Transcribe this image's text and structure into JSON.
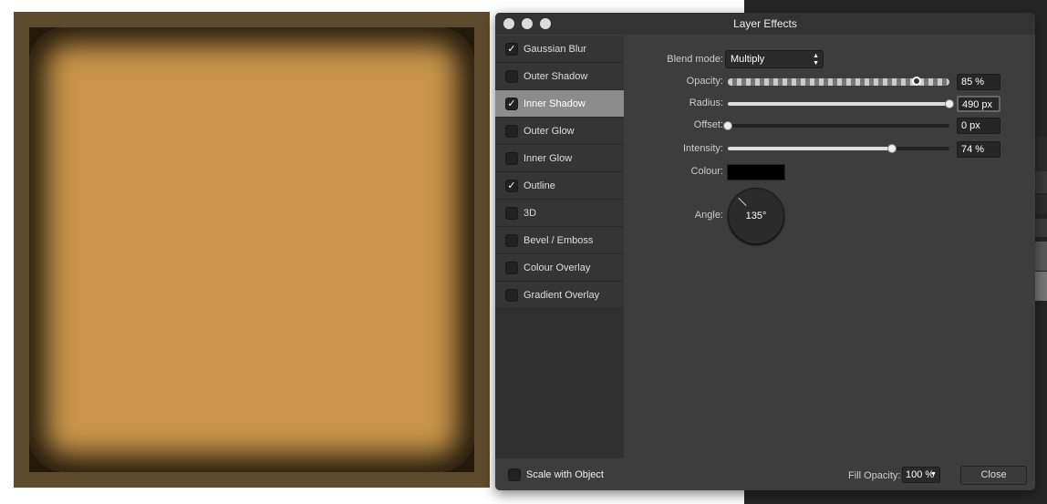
{
  "dialog": {
    "title": "Layer Effects"
  },
  "effects": [
    {
      "label": "Gaussian Blur",
      "checked": true
    },
    {
      "label": "Outer Shadow",
      "checked": false
    },
    {
      "label": "Inner Shadow",
      "checked": true,
      "selected": true
    },
    {
      "label": "Outer Glow",
      "checked": false
    },
    {
      "label": "Inner Glow",
      "checked": false
    },
    {
      "label": "Outline",
      "checked": true
    },
    {
      "label": "3D",
      "checked": false
    },
    {
      "label": "Bevel / Emboss",
      "checked": false
    },
    {
      "label": "Colour Overlay",
      "checked": false
    },
    {
      "label": "Gradient Overlay",
      "checked": false
    }
  ],
  "settings": {
    "blend_label": "Blend mode:",
    "blend_value": "Multiply",
    "opacity_label": "Opacity:",
    "opacity_value": "85 %",
    "opacity": 85,
    "radius_label": "Radius:",
    "radius_value": "490 px",
    "radius_fraction": 1.0,
    "offset_label": "Offset:",
    "offset_value": "0 px",
    "offset_fraction": 0,
    "intensity_label": "Intensity:",
    "intensity_value": "74 %",
    "intensity": 74,
    "colour_label": "Colour:",
    "colour": "#000000",
    "angle_label": "Angle:",
    "angle_value": "135°"
  },
  "footer": {
    "scale_label": "Scale with Object",
    "fill_opacity_label": "Fill Opacity:",
    "fill_opacity_value": "100 %",
    "close_label": "Close"
  }
}
